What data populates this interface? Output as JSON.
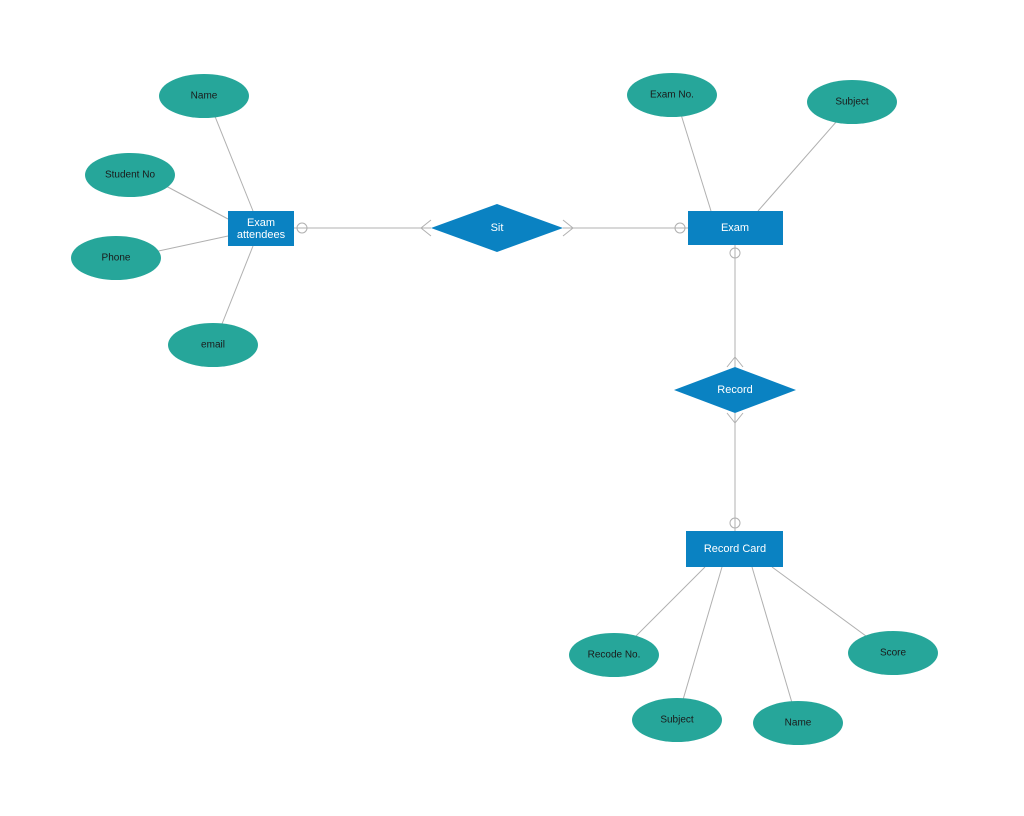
{
  "entities": {
    "examAttendees": "Exam\nattendees",
    "exam": "Exam",
    "recordCard": "Record Card"
  },
  "relationships": {
    "sit": "Sit",
    "record": "Record"
  },
  "attributes": {
    "name1": "Name",
    "studentNo": "Student No",
    "phone": "Phone",
    "email": "email",
    "examNo": "Exam No.",
    "subject1": "Subject",
    "recodeNo": "Recode No.",
    "subject2": "Subject",
    "name2": "Name",
    "score": "Score"
  },
  "colors": {
    "entity": "#0a82c2",
    "attribute": "#26a69a",
    "connector": "#b0b0b0"
  }
}
